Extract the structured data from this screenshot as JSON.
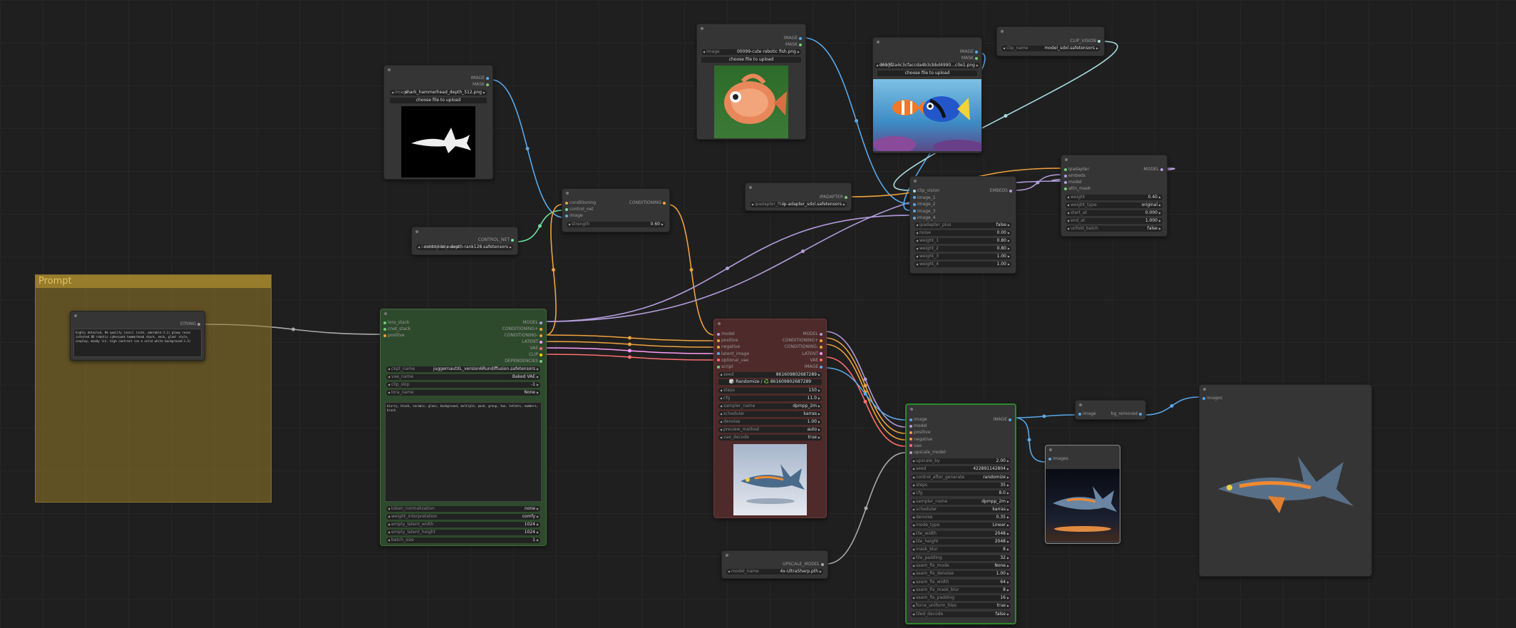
{
  "links": {
    "image": "#5aa8e8",
    "conditioning": "#f0a23c",
    "clip_vision": "#a8dadc",
    "model": "#b39ddb",
    "latent": "#ff9cf9",
    "vae": "#ff6e6e",
    "upscale_model": "#aaa",
    "controlnet": "#6ee0a0",
    "string": "#aaa"
  },
  "group": {
    "title": "Prompt",
    "color": "#a1882e"
  },
  "primitive": {
    "out": "STRING",
    "text": "highly detailed, 8k quality (zoic) (cute, adorable:1.1) glowy roses infested 8D robotic cyberpunk hammerhead shark, neck, glow! style, cosplay, moody lit, high contrast (on a solid white background:1.3)"
  },
  "load_shark": {
    "out_image": "IMAGE",
    "out_mask": "MASK",
    "w_name": "image",
    "w_value": "shark_hammerhead_depth_512.png",
    "upload": "choose file to upload"
  },
  "controlnet_loader": {
    "out": "CONTROL_NET",
    "w_name": "control_net_name",
    "w_value": "control-lora-depth-rank128.safetensors"
  },
  "apply_cn": {
    "in1": "conditioning",
    "in2": "control_net",
    "in3": "image",
    "out": "CONDITIONING",
    "w_name": "strength",
    "w_value": "0.60"
  },
  "load_fish": {
    "out_image": "IMAGE",
    "out_mask": "MASK",
    "w_name": "image",
    "w_value": "00099-cute robotic fish.png",
    "upload": "choose file to upload"
  },
  "load_nemo": {
    "out_image": "IMAGE",
    "out_mask": "MASK",
    "w_name": "image",
    "w_value": "d693f2a4c3cfaccda4b3cbbd4990...c0e1.png",
    "upload": "choose file to upload"
  },
  "clip_vision_loader": {
    "out": "CLIP_VISION",
    "w_name": "clip_name",
    "w_value": "model_sdxl.safetensors"
  },
  "ipadapter_loader": {
    "out": "IPADAPTER",
    "w_name": "ipadapter_file",
    "w_value": "ip-adapter_sdxl.safetensors"
  },
  "encoder": {
    "inputs": [
      "clip_vision",
      "image_1",
      "image_2",
      "image_3",
      "image_4"
    ],
    "out": "EMBEDS",
    "widgets": [
      {
        "n": "ipadapter_plus",
        "v": "false"
      },
      {
        "n": "noise",
        "v": "0.00"
      },
      {
        "n": "weight_1",
        "v": "0.80"
      },
      {
        "n": "weight_2",
        "v": "0.80"
      },
      {
        "n": "weight_3",
        "v": "1.00"
      },
      {
        "n": "weight_4",
        "v": "1.00"
      }
    ]
  },
  "apply_ip": {
    "inputs": [
      "ipadapter",
      "embeds",
      "model",
      "attn_mask"
    ],
    "out": "MODEL",
    "widgets": [
      {
        "n": "weight",
        "v": "0.40"
      },
      {
        "n": "weight_type",
        "v": "original"
      },
      {
        "n": "start_at",
        "v": "0.000"
      },
      {
        "n": "end_at",
        "v": "1.000"
      },
      {
        "n": "unfold_batch",
        "v": "false"
      }
    ]
  },
  "efficient_loader": {
    "inputs": [
      "lora_stack",
      "cnet_stack",
      "positive"
    ],
    "outputs": [
      "MODEL",
      "CONDITIONING+",
      "CONDITIONING-",
      "LATENT",
      "VAE",
      "CLIP",
      "DEPENDENCIES"
    ],
    "widgets": [
      {
        "n": "ckpt_name",
        "v": "juggernautXL_version6Rundiffusion.safetensors"
      },
      {
        "n": "vae_name",
        "v": "Baked VAE"
      },
      {
        "n": "clip_skip",
        "v": "-1"
      },
      {
        "n": "lora_name",
        "v": "None"
      }
    ],
    "neg": "blurry, black, ceramic, glass, background, multiple, pack, group, two, letters, numbers, brush",
    "widgets2": [
      {
        "n": "token_normalization",
        "v": "none"
      },
      {
        "n": "weight_interpretation",
        "v": "comfy"
      },
      {
        "n": "empty_latent_width",
        "v": "1024"
      },
      {
        "n": "empty_latent_height",
        "v": "1024"
      },
      {
        "n": "batch_size",
        "v": "1"
      }
    ]
  },
  "ksampler": {
    "inputs": [
      "model",
      "positive",
      "negative",
      "latent_image",
      "optional_vae",
      "script"
    ],
    "outputs": [
      "MODEL",
      "CONDITIONING+",
      "CONDITIONING-",
      "LATENT",
      "VAE",
      "IMAGE"
    ],
    "seed_w": {
      "n": "seed",
      "v": "861609802687289"
    },
    "randomize": "🎲 Randomize / ♻️ 861609802687289",
    "widgets": [
      {
        "n": "steps",
        "v": "150"
      },
      {
        "n": "cfg",
        "v": "11.0"
      },
      {
        "n": "sampler_name",
        "v": "dpmpp_2m"
      },
      {
        "n": "scheduler",
        "v": "karras"
      },
      {
        "n": "denoise",
        "v": "1.00"
      },
      {
        "n": "preview_method",
        "v": "auto"
      },
      {
        "n": "vae_decode",
        "v": "true"
      }
    ]
  },
  "upscale_loader": {
    "out": "UPSCALE_MODEL",
    "w_name": "model_name",
    "w_value": "4x-UltraSharp.pth"
  },
  "ultimate": {
    "inputs": [
      "image",
      "model",
      "positive",
      "negative",
      "vae",
      "upscale_model"
    ],
    "out": "IMAGE",
    "widgets": [
      {
        "n": "upscale_by",
        "v": "2.00"
      },
      {
        "n": "seed",
        "v": "422891142804"
      },
      {
        "n": "control_after_generate",
        "v": "randomize"
      },
      {
        "n": "steps",
        "v": "35"
      },
      {
        "n": "cfg",
        "v": "8.0"
      },
      {
        "n": "sampler_name",
        "v": "dpmpp_2m"
      },
      {
        "n": "scheduler",
        "v": "karras"
      },
      {
        "n": "denoise",
        "v": "0.35"
      },
      {
        "n": "mode_type",
        "v": "Linear"
      },
      {
        "n": "tile_width",
        "v": "2048"
      },
      {
        "n": "tile_height",
        "v": "2048"
      },
      {
        "n": "mask_blur",
        "v": "8"
      },
      {
        "n": "tile_padding",
        "v": "32"
      },
      {
        "n": "seam_fix_mode",
        "v": "None"
      },
      {
        "n": "seam_fix_denoise",
        "v": "1.00"
      },
      {
        "n": "seam_fix_width",
        "v": "64"
      },
      {
        "n": "seam_fix_mask_blur",
        "v": "8"
      },
      {
        "n": "seam_fix_padding",
        "v": "16"
      },
      {
        "n": "force_uniform_tiles",
        "v": "true"
      },
      {
        "n": "tiled_decode",
        "v": "false"
      }
    ]
  },
  "rembg": {
    "in": "image",
    "out": "bg_removed"
  },
  "preview1": {
    "in": "images"
  },
  "preview2": {
    "in": "images"
  }
}
